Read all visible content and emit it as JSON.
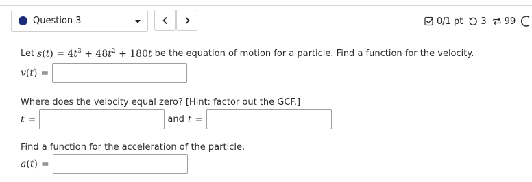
{
  "header": {
    "question_label": "Question 3",
    "points": "0/1 pt",
    "attempts_count": "3",
    "retries_count": "99",
    "colors": {
      "question_dot": "#1c2a7a",
      "border": "#cfcfcf"
    }
  },
  "problem": {
    "intro_prefix": "Let",
    "intro_suffix": "be the equation of motion for a particle. Find a function for the velocity.",
    "hint_text": "Where does the velocity equal zero? [Hint: factor out the GCF.]",
    "and_text": "and",
    "acceleration_text": "Find a function for the acceleration of the particle.",
    "inputs": {
      "velocity": "",
      "t_first": "",
      "t_second": "",
      "acceleration": ""
    }
  }
}
